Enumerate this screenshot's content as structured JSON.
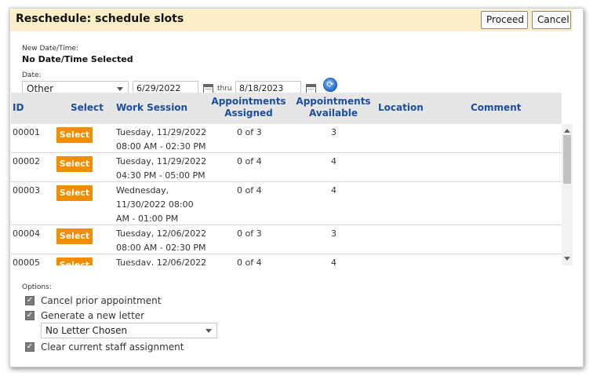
{
  "dialog": {
    "title": "Reschedule: schedule slots",
    "proceed_label": "Proceed",
    "cancel_label": "Cancel"
  },
  "new_datetime": {
    "label": "New Date/Time:",
    "value": "No Date/Time Selected"
  },
  "date_filter": {
    "label": "Date:",
    "range_option": "Other",
    "from_date": "6/29/2022",
    "thru_label": "thru",
    "to_date": "8/18/2023"
  },
  "table": {
    "headers": {
      "id": "ID",
      "select": "Select",
      "work_session": "Work Session",
      "assigned_line1": "Appointments",
      "assigned_line2": "Assigned",
      "available_line1": "Appointments",
      "available_line2": "Available",
      "location": "Location",
      "comment": "Comment"
    },
    "select_label": "Select",
    "rows": [
      {
        "id": "00001",
        "session": [
          "Tuesday, 11/29/2022",
          "08:00 AM - 02:30 PM"
        ],
        "assigned": "0 of 3",
        "available": "3"
      },
      {
        "id": "00002",
        "session": [
          "Tuesday, 11/29/2022",
          "04:30 PM - 05:00 PM"
        ],
        "assigned": "0 of 4",
        "available": "4"
      },
      {
        "id": "00003",
        "session": [
          "Wednesday,",
          "11/30/2022 08:00",
          "AM - 01:00 PM"
        ],
        "assigned": "0 of 4",
        "available": "4"
      },
      {
        "id": "00004",
        "session": [
          "Tuesday, 12/06/2022",
          "08:00 AM - 02:30 PM"
        ],
        "assigned": "0 of 3",
        "available": "3"
      },
      {
        "id": "00005",
        "session": [
          "Tuesday, 12/06/2022",
          ""
        ],
        "assigned": "0 of 4",
        "available": "4"
      }
    ]
  },
  "options": {
    "label": "Options:",
    "cancel_prior": "Cancel prior appointment",
    "generate_letter": "Generate a new letter",
    "letter_select": "No Letter Chosen",
    "clear_staff": "Clear current staff assignment"
  },
  "colors": {
    "titlebar_bg": "#fcefc7",
    "header_text": "#1a4fa0",
    "select_button": "#f28c00"
  }
}
